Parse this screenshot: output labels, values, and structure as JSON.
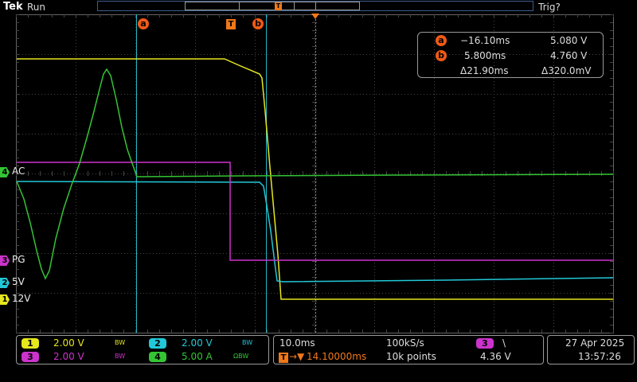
{
  "header": {
    "logo": "Tek",
    "run_state": "Run",
    "trigger_state": "Trig?"
  },
  "markers": {
    "cursor_a": "a",
    "cursor_b": "b",
    "trigger": "T"
  },
  "cursor_readout": {
    "a": {
      "label": "a",
      "time": "−16.10ms",
      "value": "5.080 V"
    },
    "b": {
      "label": "b",
      "time": "5.800ms",
      "value": "4.760 V"
    },
    "delta_time": "Δ21.90ms",
    "delta_value": "Δ320.0mV"
  },
  "channel_labels": [
    {
      "num": "4",
      "name": "AC",
      "color": "#34c434"
    },
    {
      "num": "3",
      "name": "PG",
      "color": "#cc33cc"
    },
    {
      "num": "2",
      "name": "5V",
      "color": "#22c8d8"
    },
    {
      "num": "1",
      "name": "12V",
      "color": "#e6e61e"
    }
  ],
  "channels_panel": {
    "ch1": {
      "num": "1",
      "scale": "2.00 V",
      "bw": "BW",
      "color": "#e6e61e"
    },
    "ch2": {
      "num": "2",
      "scale": "2.00 V",
      "bw": "BW",
      "color": "#22c8d8"
    },
    "ch3": {
      "num": "3",
      "scale": "2.00 V",
      "bw": "BW",
      "color": "#cc33cc"
    },
    "ch4": {
      "num": "4",
      "scale": "5.00 A",
      "bw": "ΩBW",
      "color": "#34c434"
    }
  },
  "timebase": {
    "scale": "10.0ms",
    "sample_rate": "100kS/s",
    "trigger_position": "14.10000ms",
    "record_length": "10k points"
  },
  "trigger": {
    "source": "3",
    "slope": "\\",
    "level": "4.36 V"
  },
  "datetime": {
    "date": "27 Apr  2025",
    "time": "13:57:26"
  }
}
